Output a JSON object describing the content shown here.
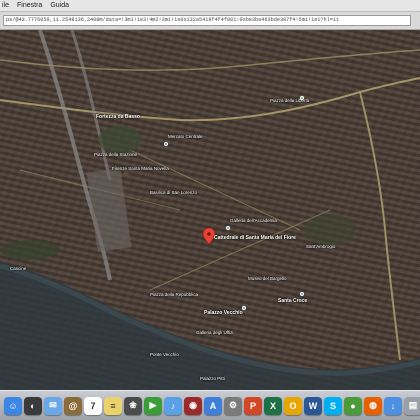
{
  "menubar": {
    "items": [
      "ile",
      "Finestra",
      "Guida"
    ]
  },
  "urlbar": {
    "url": "ps/@43.7776059,11.2548136,2408m/data=!3m1!1e3!4m2!3m1!1s0x132a5419f4f4f001:0xbe3ba463bde307f4!5m1!1e1?hl=it"
  },
  "map": {
    "labels": [
      {
        "text": "Fortezza da Basso"
      },
      {
        "text": "Piazza della Stazione"
      },
      {
        "text": "Firenze Santa Maria Novella"
      },
      {
        "text": "Mercato Centrale"
      },
      {
        "text": "Basilica di San Lorenzo"
      },
      {
        "text": "Cattedrale di Santa Maria del Fiore"
      },
      {
        "text": "Galleria dell'Accademia"
      },
      {
        "text": "Piazza della Repubblica"
      },
      {
        "text": "Palazzo Vecchio"
      },
      {
        "text": "Galleria degli Uffizi"
      },
      {
        "text": "Ponte Vecchio"
      },
      {
        "text": "Palazzo Pitti"
      },
      {
        "text": "Santa Croce"
      },
      {
        "text": "Sant'Ambrogio"
      },
      {
        "text": "Piazza della Libertà"
      },
      {
        "text": "Cascine"
      },
      {
        "text": "Museo del Bargello"
      }
    ],
    "river_color": "#2e3a40",
    "road_color": "#a89c6a",
    "marker_color": "#e84235"
  },
  "dock": {
    "icons": [
      {
        "name": "finder-icon",
        "glyph": "☺",
        "color": "#3d86e6"
      },
      {
        "name": "dashboard-icon",
        "glyph": "◐",
        "color": "#3a3a3a"
      },
      {
        "name": "mail-icon",
        "glyph": "✉",
        "color": "#6aa8e8"
      },
      {
        "name": "contacts-icon",
        "glyph": "@",
        "color": "#8a6b3a"
      },
      {
        "name": "calendar-icon",
        "glyph": "7",
        "color": "#ffffff"
      },
      {
        "name": "notes-icon",
        "glyph": "≡",
        "color": "#e9d36a"
      },
      {
        "name": "photos-icon",
        "glyph": "❀",
        "color": "#4c4c4c"
      },
      {
        "name": "facetime-icon",
        "glyph": "▶",
        "color": "#3a9d3a"
      },
      {
        "name": "itunes-icon",
        "glyph": "♪",
        "color": "#5aa0e6"
      },
      {
        "name": "photobooth-icon",
        "glyph": "◉",
        "color": "#9b2a2a"
      },
      {
        "name": "appstore-icon",
        "glyph": "A",
        "color": "#3d7fd9"
      },
      {
        "name": "preferences-icon",
        "glyph": "⚙",
        "color": "#7b7b7b"
      },
      {
        "name": "powerpoint-icon",
        "glyph": "P",
        "color": "#d24726"
      },
      {
        "name": "excel-icon",
        "glyph": "X",
        "color": "#1e7145"
      },
      {
        "name": "outlook-icon",
        "glyph": "O",
        "color": "#e8a500"
      },
      {
        "name": "word-icon",
        "glyph": "W",
        "color": "#2b5797"
      },
      {
        "name": "skype-icon",
        "glyph": "S",
        "color": "#00aff0"
      },
      {
        "name": "chrome-icon",
        "glyph": "●",
        "color": "#4c9a3b"
      },
      {
        "name": "firefox-icon",
        "glyph": "◍",
        "color": "#e66000"
      },
      {
        "name": "downloads-icon",
        "glyph": "↓",
        "color": "#4d8fe0"
      },
      {
        "name": "documents-icon",
        "glyph": "▤",
        "color": "#9aa0a8"
      },
      {
        "name": "trash-icon",
        "glyph": "🗑",
        "color": "#b7bcc3"
      }
    ]
  }
}
